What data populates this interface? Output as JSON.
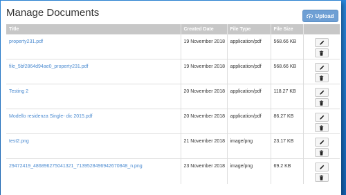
{
  "page": {
    "title": "Manage Documents",
    "upload_label": "Upload"
  },
  "table": {
    "columns": [
      "Title",
      "Created Date",
      "File Type",
      "File Size",
      ""
    ],
    "rows": [
      {
        "title": "property231.pdf",
        "created": "19 November 2018",
        "type": "application/pdf",
        "size": "568.66 KB"
      },
      {
        "title": "file_5bf2864d94ae0_property231.pdf",
        "created": "19 November 2018",
        "type": "application/pdf",
        "size": "568.66 KB"
      },
      {
        "title": "Testing 2",
        "created": "20 November 2018",
        "type": "application/pdf",
        "size": "118.27 KB"
      },
      {
        "title": "Modello residenza Single- dic 2015.pdf",
        "created": "20 November 2018",
        "type": "application/pdf",
        "size": "86.27 KB"
      },
      {
        "title": "test2.png",
        "created": "21 November 2018",
        "type": "image/png",
        "size": "23.17 KB"
      },
      {
        "title": "29472419_486896275041321_7139528496942670848_n.png",
        "created": "23 November 2018",
        "type": "image/png",
        "size": "69.2 KB"
      }
    ]
  },
  "icons": {
    "upload": "cloud-upload-icon",
    "edit": "pencil-icon",
    "delete": "trash-icon"
  },
  "colors": {
    "accent": "#6e9fd4",
    "link": "#4a8ad0",
    "header_bg": "#c7c7c7",
    "backdrop": "#1a6fc4"
  }
}
